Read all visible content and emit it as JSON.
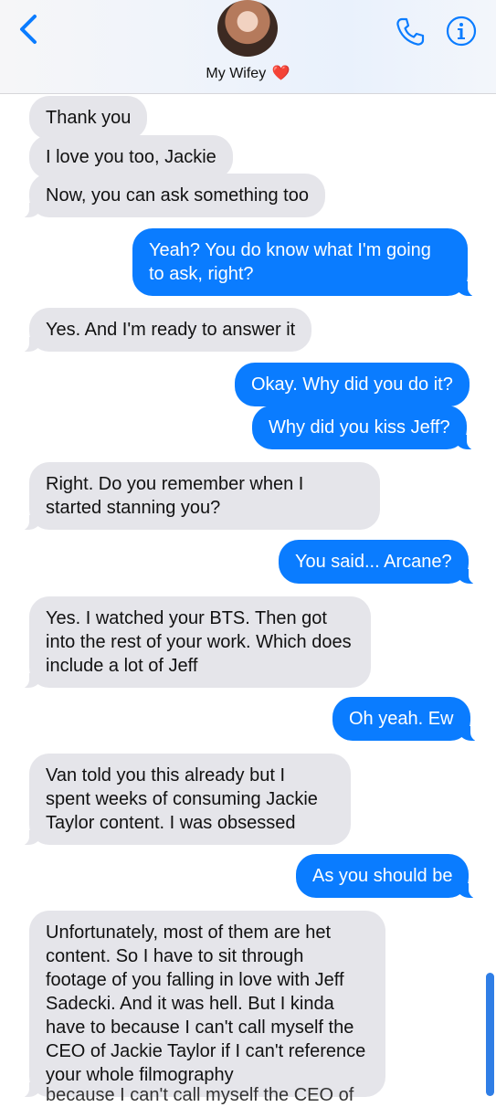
{
  "header": {
    "contact_name": "My Wifey",
    "heart": "❤️",
    "icons": [
      "back-chevron-icon",
      "avatar",
      "phone-icon",
      "info-icon"
    ],
    "accent_color": "#0a7cff"
  },
  "messages": [
    {
      "dir": "in",
      "text": "Thank you"
    },
    {
      "dir": "in",
      "text": "I love you too, Jackie"
    },
    {
      "dir": "in",
      "text": "Now, you can ask something too"
    },
    {
      "dir": "out",
      "text": "Yeah? You do know what I'm going to ask, right?"
    },
    {
      "dir": "in",
      "text": "Yes. And I'm ready to answer it"
    },
    {
      "dir": "out",
      "text": "Okay. Why did you do it?"
    },
    {
      "dir": "out",
      "text": "Why did you kiss Jeff?"
    },
    {
      "dir": "in",
      "text": "Right. Do you remember when I started stanning you?"
    },
    {
      "dir": "out",
      "text": "You said... Arcane?"
    },
    {
      "dir": "in",
      "text": "Yes. I watched your BTS. Then got into the rest of your work. Which does include a lot of Jeff"
    },
    {
      "dir": "out",
      "text": "Oh yeah. Ew"
    },
    {
      "dir": "in",
      "text": "Van told you this already but I spent weeks of consuming Jackie Taylor content. I was obsessed"
    },
    {
      "dir": "out",
      "text": "As you should be"
    },
    {
      "dir": "in",
      "text": "Unfortunately, most of them are het content. So I have to sit through footage of you falling in love with Jeff Sadecki. And it was hell. But I kinda have to because I can't call myself the CEO of Jackie Taylor if I can't reference your whole filmography"
    }
  ],
  "cutoff_text": "because I can't call myself the CEO of"
}
